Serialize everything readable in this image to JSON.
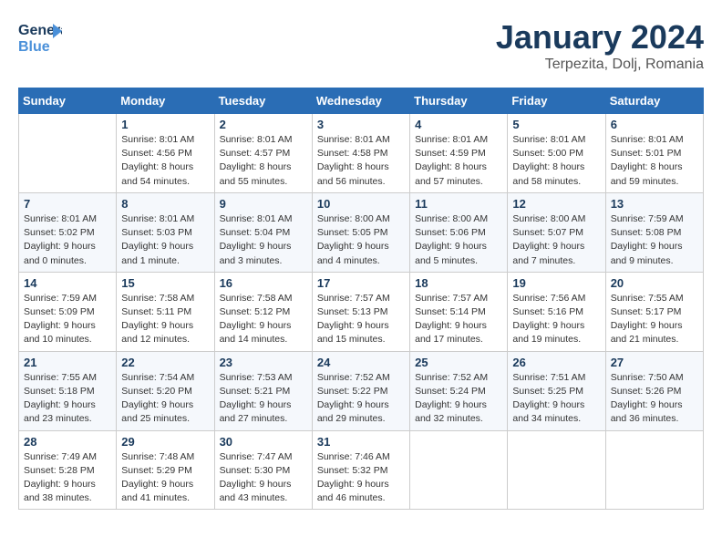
{
  "logo": {
    "line1": "General",
    "line2": "Blue"
  },
  "title": "January 2024",
  "subtitle": "Terpezita, Dolj, Romania",
  "headers": [
    "Sunday",
    "Monday",
    "Tuesday",
    "Wednesday",
    "Thursday",
    "Friday",
    "Saturday"
  ],
  "weeks": [
    [
      {
        "day": "",
        "info": ""
      },
      {
        "day": "1",
        "info": "Sunrise: 8:01 AM\nSunset: 4:56 PM\nDaylight: 8 hours\nand 54 minutes."
      },
      {
        "day": "2",
        "info": "Sunrise: 8:01 AM\nSunset: 4:57 PM\nDaylight: 8 hours\nand 55 minutes."
      },
      {
        "day": "3",
        "info": "Sunrise: 8:01 AM\nSunset: 4:58 PM\nDaylight: 8 hours\nand 56 minutes."
      },
      {
        "day": "4",
        "info": "Sunrise: 8:01 AM\nSunset: 4:59 PM\nDaylight: 8 hours\nand 57 minutes."
      },
      {
        "day": "5",
        "info": "Sunrise: 8:01 AM\nSunset: 5:00 PM\nDaylight: 8 hours\nand 58 minutes."
      },
      {
        "day": "6",
        "info": "Sunrise: 8:01 AM\nSunset: 5:01 PM\nDaylight: 8 hours\nand 59 minutes."
      }
    ],
    [
      {
        "day": "7",
        "info": "Sunrise: 8:01 AM\nSunset: 5:02 PM\nDaylight: 9 hours\nand 0 minutes."
      },
      {
        "day": "8",
        "info": "Sunrise: 8:01 AM\nSunset: 5:03 PM\nDaylight: 9 hours\nand 1 minute."
      },
      {
        "day": "9",
        "info": "Sunrise: 8:01 AM\nSunset: 5:04 PM\nDaylight: 9 hours\nand 3 minutes."
      },
      {
        "day": "10",
        "info": "Sunrise: 8:00 AM\nSunset: 5:05 PM\nDaylight: 9 hours\nand 4 minutes."
      },
      {
        "day": "11",
        "info": "Sunrise: 8:00 AM\nSunset: 5:06 PM\nDaylight: 9 hours\nand 5 minutes."
      },
      {
        "day": "12",
        "info": "Sunrise: 8:00 AM\nSunset: 5:07 PM\nDaylight: 9 hours\nand 7 minutes."
      },
      {
        "day": "13",
        "info": "Sunrise: 7:59 AM\nSunset: 5:08 PM\nDaylight: 9 hours\nand 9 minutes."
      }
    ],
    [
      {
        "day": "14",
        "info": "Sunrise: 7:59 AM\nSunset: 5:09 PM\nDaylight: 9 hours\nand 10 minutes."
      },
      {
        "day": "15",
        "info": "Sunrise: 7:58 AM\nSunset: 5:11 PM\nDaylight: 9 hours\nand 12 minutes."
      },
      {
        "day": "16",
        "info": "Sunrise: 7:58 AM\nSunset: 5:12 PM\nDaylight: 9 hours\nand 14 minutes."
      },
      {
        "day": "17",
        "info": "Sunrise: 7:57 AM\nSunset: 5:13 PM\nDaylight: 9 hours\nand 15 minutes."
      },
      {
        "day": "18",
        "info": "Sunrise: 7:57 AM\nSunset: 5:14 PM\nDaylight: 9 hours\nand 17 minutes."
      },
      {
        "day": "19",
        "info": "Sunrise: 7:56 AM\nSunset: 5:16 PM\nDaylight: 9 hours\nand 19 minutes."
      },
      {
        "day": "20",
        "info": "Sunrise: 7:55 AM\nSunset: 5:17 PM\nDaylight: 9 hours\nand 21 minutes."
      }
    ],
    [
      {
        "day": "21",
        "info": "Sunrise: 7:55 AM\nSunset: 5:18 PM\nDaylight: 9 hours\nand 23 minutes."
      },
      {
        "day": "22",
        "info": "Sunrise: 7:54 AM\nSunset: 5:20 PM\nDaylight: 9 hours\nand 25 minutes."
      },
      {
        "day": "23",
        "info": "Sunrise: 7:53 AM\nSunset: 5:21 PM\nDaylight: 9 hours\nand 27 minutes."
      },
      {
        "day": "24",
        "info": "Sunrise: 7:52 AM\nSunset: 5:22 PM\nDaylight: 9 hours\nand 29 minutes."
      },
      {
        "day": "25",
        "info": "Sunrise: 7:52 AM\nSunset: 5:24 PM\nDaylight: 9 hours\nand 32 minutes."
      },
      {
        "day": "26",
        "info": "Sunrise: 7:51 AM\nSunset: 5:25 PM\nDaylight: 9 hours\nand 34 minutes."
      },
      {
        "day": "27",
        "info": "Sunrise: 7:50 AM\nSunset: 5:26 PM\nDaylight: 9 hours\nand 36 minutes."
      }
    ],
    [
      {
        "day": "28",
        "info": "Sunrise: 7:49 AM\nSunset: 5:28 PM\nDaylight: 9 hours\nand 38 minutes."
      },
      {
        "day": "29",
        "info": "Sunrise: 7:48 AM\nSunset: 5:29 PM\nDaylight: 9 hours\nand 41 minutes."
      },
      {
        "day": "30",
        "info": "Sunrise: 7:47 AM\nSunset: 5:30 PM\nDaylight: 9 hours\nand 43 minutes."
      },
      {
        "day": "31",
        "info": "Sunrise: 7:46 AM\nSunset: 5:32 PM\nDaylight: 9 hours\nand 46 minutes."
      },
      {
        "day": "",
        "info": ""
      },
      {
        "day": "",
        "info": ""
      },
      {
        "day": "",
        "info": ""
      }
    ]
  ]
}
